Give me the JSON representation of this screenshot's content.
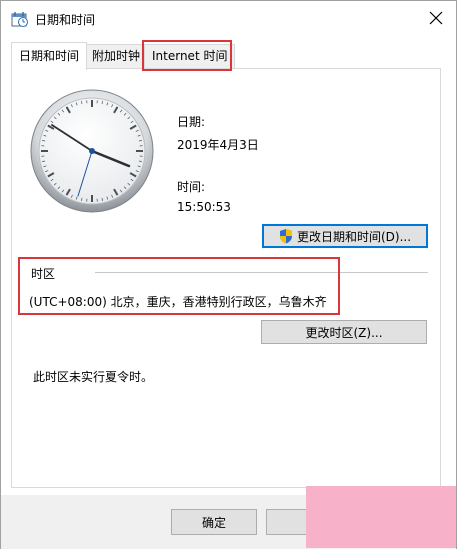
{
  "window": {
    "title": "日期和时间",
    "icon": "clock-app-icon",
    "close_icon": "close-icon"
  },
  "tabs": [
    {
      "label": "日期和时间",
      "active": true
    },
    {
      "label": "附加时钟",
      "active": false
    },
    {
      "label": "Internet 时间",
      "active": false,
      "highlighted": true
    }
  ],
  "datetime": {
    "date_label": "日期:",
    "date_value": "2019年4月3日",
    "time_label": "时间:",
    "time_value": "15:50:53",
    "change_button": "更改日期和时间(D)..."
  },
  "timezone": {
    "group_label": "时区",
    "value": "(UTC+08:00) 北京，重庆，香港特别行政区，乌鲁木齐",
    "change_button": "更改时区(Z)...",
    "dst_note": "此时区未实行夏令时。",
    "highlighted": true
  },
  "footer": {
    "ok_button": "确定"
  },
  "colors": {
    "highlight_border": "#d9353b",
    "focus_border": "#0078d7",
    "watermark": "#f7b2c9"
  }
}
